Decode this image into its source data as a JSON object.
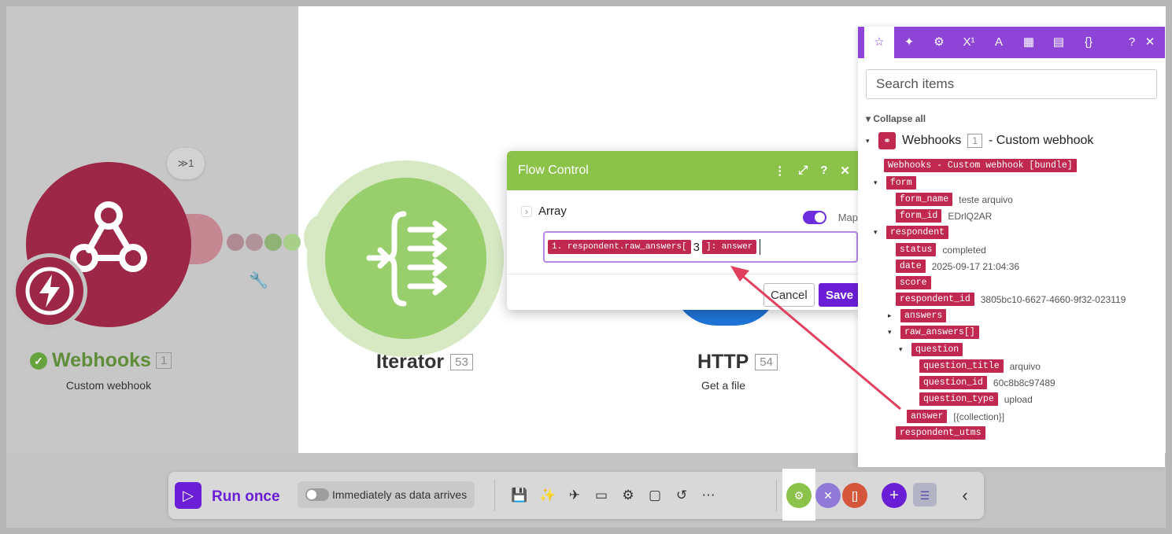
{
  "webhooks_module": {
    "run_count": "≫1",
    "name": "Webhooks",
    "id": "1",
    "subtitle": "Custom webhook"
  },
  "iterator_module": {
    "name": "Iterator",
    "id": "53"
  },
  "http_module": {
    "name": "HTTP",
    "id": "54",
    "subtitle": "Get a file"
  },
  "flow_control": {
    "title": "Flow Control",
    "header_icons": [
      "⋮",
      "⤢",
      "?",
      "✕"
    ],
    "array_label": "Array",
    "map_label": "Map",
    "field_token_1": "1. respondent.raw_answers[",
    "field_plain": "3",
    "field_token_2": "]: answer",
    "cancel_label": "Cancel",
    "save_label": "Save"
  },
  "mapping_panel": {
    "tabs": [
      "☆",
      "✦",
      "⚙",
      "X¹",
      "A",
      "▦",
      "▤",
      "{}",
      "?",
      "✕"
    ],
    "search_placeholder": "Search items",
    "collapse_label": "▾ Collapse all",
    "root_label": "Webhooks",
    "root_id": "1",
    "root_suffix": "- Custom webhook",
    "bundle_label": "Webhooks - Custom webhook [bundle]",
    "items": {
      "form": "form",
      "form_name": "form_name",
      "form_name_val": "teste arquivo",
      "form_id": "form_id",
      "form_id_val": "EDrlQ2AR",
      "respondent": "respondent",
      "status": "status",
      "status_val": "completed",
      "date": "date",
      "date_val": "2025-09-17 21:04:36",
      "score": "score",
      "respondent_id": "respondent_id",
      "respondent_id_val": "3805bc10-6627-4660-9f32-023119",
      "answers": "answers",
      "raw_answers": "raw_answers[]",
      "question": "question",
      "question_title": "question_title",
      "question_title_val": "arquivo",
      "question_id": "question_id",
      "question_id_val": "60c8b8c97489",
      "question_type": "question_type",
      "question_type_val": "upload",
      "answer": "answer",
      "answer_val": "[{collection}]",
      "respondent_utms": "respondent_utms"
    }
  },
  "toolbar": {
    "run_label": "Run once",
    "immediate_label": "Immediately as data arrives",
    "icons": [
      "💾",
      "✨",
      "✈",
      "▭",
      "⚙",
      "▢",
      "↺",
      "⋯"
    ],
    "chevron": "‹"
  },
  "colors": {
    "webhooks": "#9c2746",
    "iterator": "#98ce6c",
    "flow_header": "#8bc34a",
    "panel_accent": "#8e44d6",
    "pill": "#c0284f",
    "run": "#6a1ed6"
  }
}
